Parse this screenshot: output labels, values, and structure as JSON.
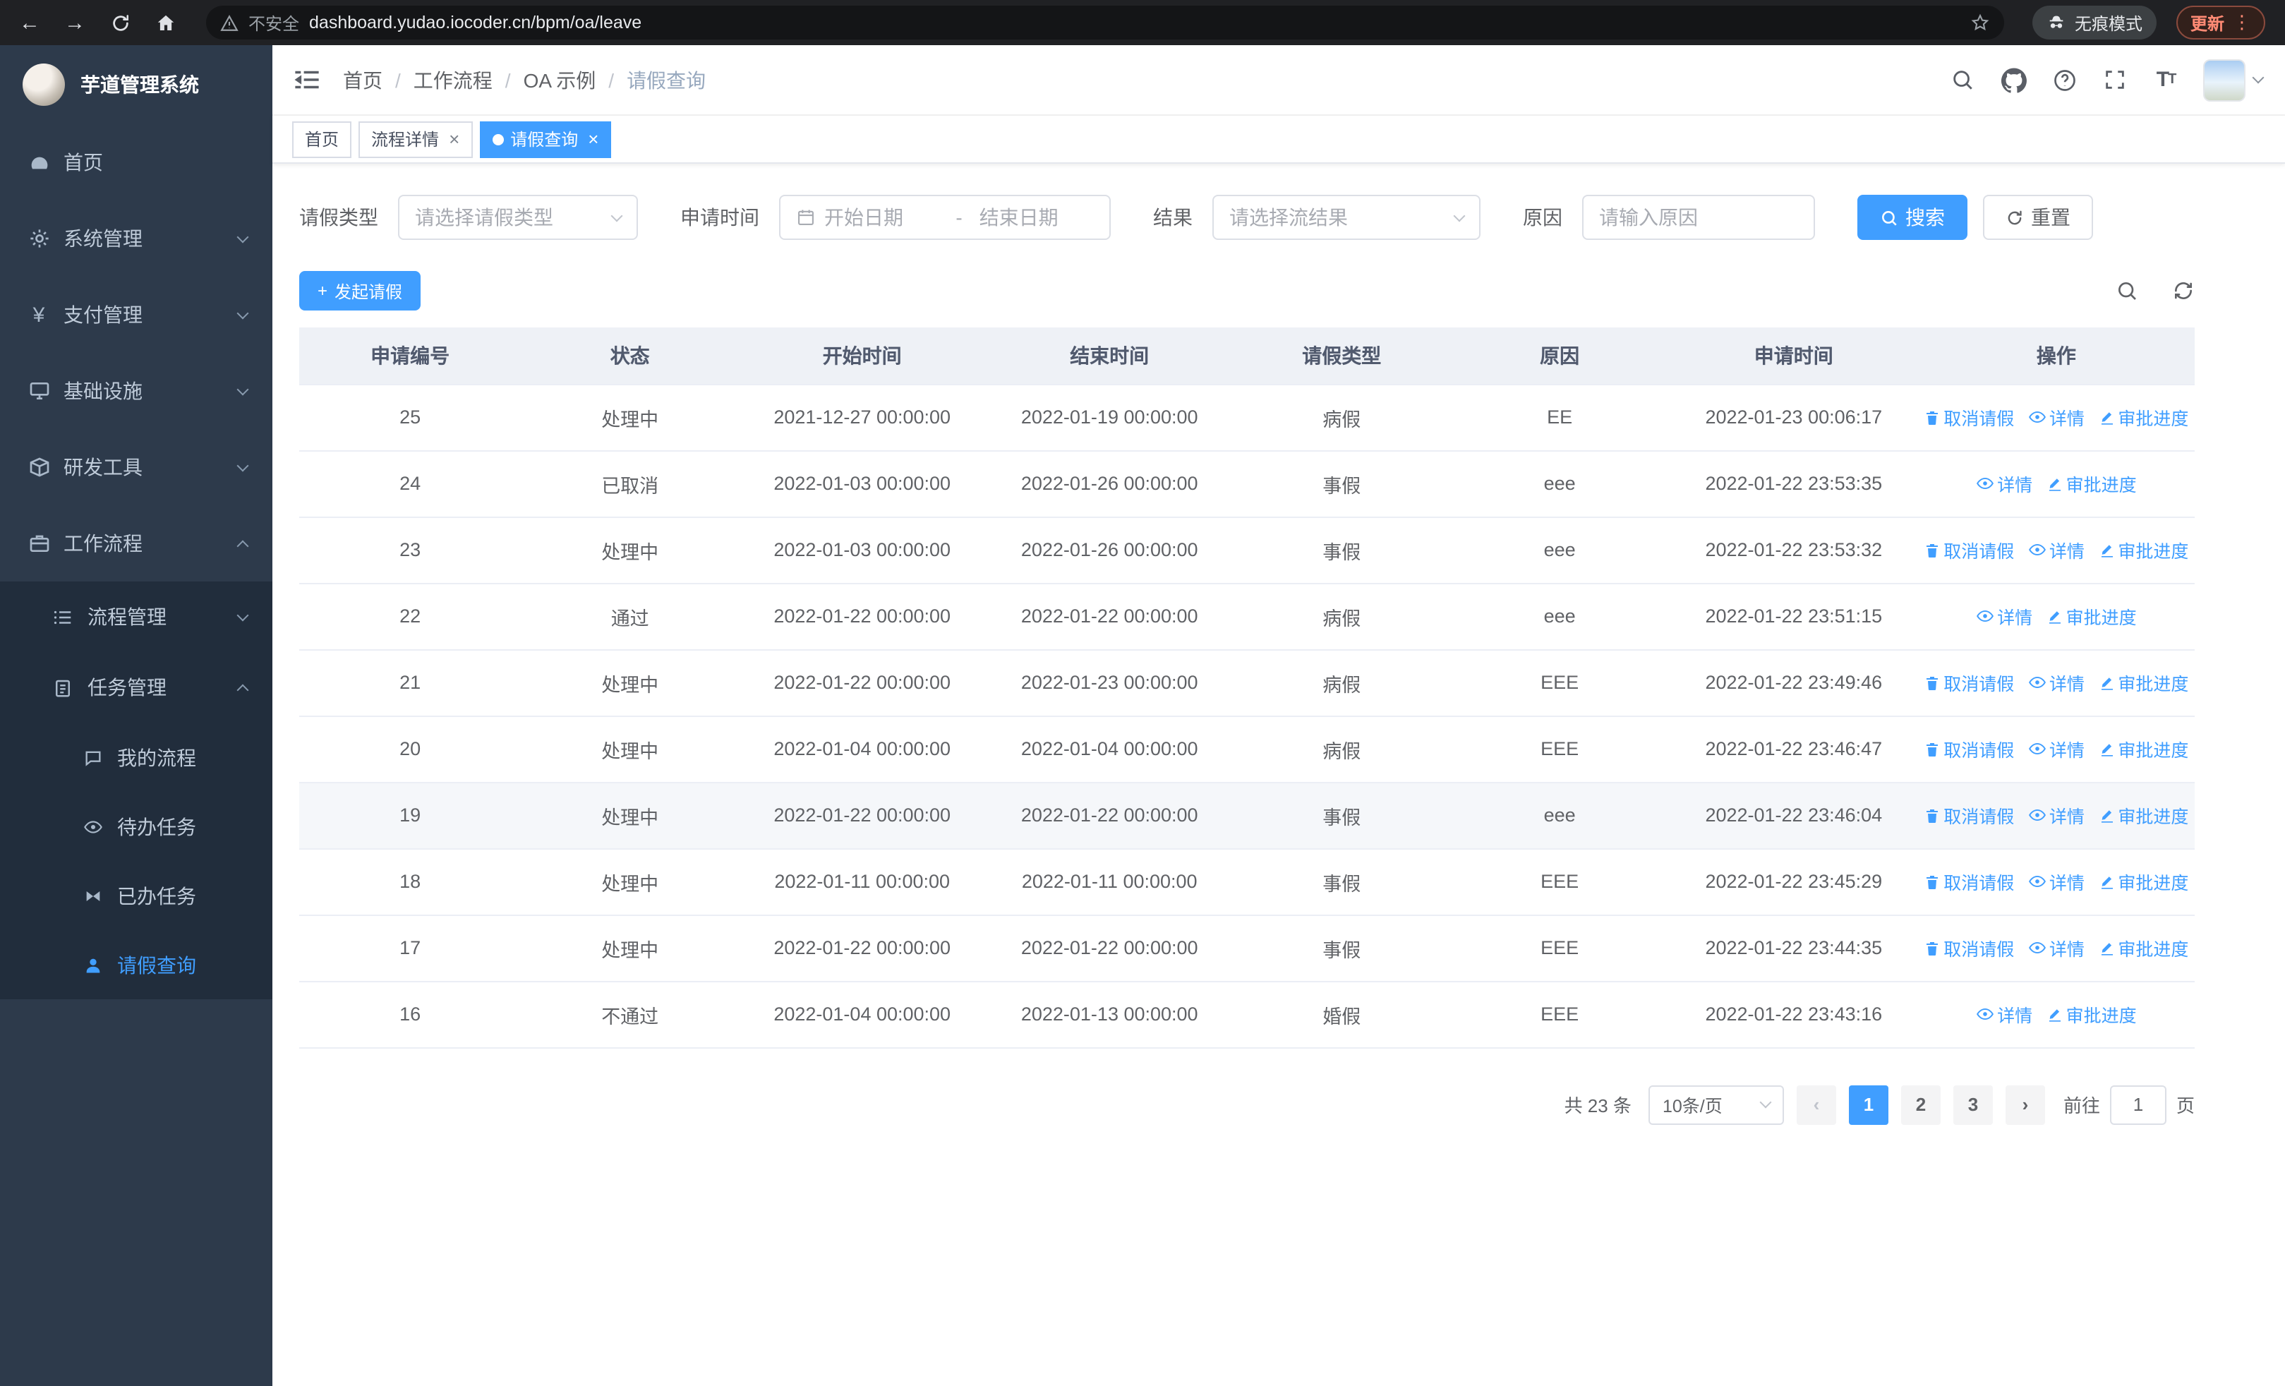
{
  "browser": {
    "security_label": "不安全",
    "url": "dashboard.yudao.iocoder.cn/bpm/oa/leave",
    "incognito_label": "无痕模式",
    "update_label": "更新"
  },
  "sidebar": {
    "title": "芋道管理系统",
    "menu": [
      {
        "label": "首页"
      },
      {
        "label": "系统管理"
      },
      {
        "label": "支付管理"
      },
      {
        "label": "基础设施"
      },
      {
        "label": "研发工具"
      },
      {
        "label": "工作流程"
      },
      {
        "label": "流程管理"
      },
      {
        "label": "任务管理"
      },
      {
        "label": "我的流程"
      },
      {
        "label": "待办任务"
      },
      {
        "label": "已办任务"
      },
      {
        "label": "请假查询"
      }
    ]
  },
  "header": {
    "breadcrumb": [
      "首页",
      "工作流程",
      "OA 示例",
      "请假查询"
    ]
  },
  "tabs": [
    {
      "label": "首页"
    },
    {
      "label": "流程详情"
    },
    {
      "label": "请假查询"
    }
  ],
  "filters": {
    "leave_type_label": "请假类型",
    "leave_type_placeholder": "请选择请假类型",
    "apply_time_label": "申请时间",
    "start_date_placeholder": "开始日期",
    "range_separator": "-",
    "end_date_placeholder": "结束日期",
    "result_label": "结果",
    "result_placeholder": "请选择流结果",
    "reason_label": "原因",
    "reason_placeholder": "请输入原因",
    "search_button": "搜索",
    "reset_button": "重置"
  },
  "toolbar": {
    "create_button": "发起请假"
  },
  "table": {
    "columns": [
      "申请编号",
      "状态",
      "开始时间",
      "结束时间",
      "请假类型",
      "原因",
      "申请时间",
      "操作"
    ],
    "ops": {
      "cancel": "取消请假",
      "detail": "详情",
      "progress": "审批进度"
    },
    "rows": [
      {
        "id": "25",
        "status": "处理中",
        "start": "2021-12-27 00:00:00",
        "end": "2022-01-19 00:00:00",
        "type": "病假",
        "reason": "EE",
        "applied": "2022-01-23 00:06:17",
        "can_cancel": true,
        "highlight": false
      },
      {
        "id": "24",
        "status": "已取消",
        "start": "2022-01-03 00:00:00",
        "end": "2022-01-26 00:00:00",
        "type": "事假",
        "reason": "eee",
        "applied": "2022-01-22 23:53:35",
        "can_cancel": false,
        "highlight": false
      },
      {
        "id": "23",
        "status": "处理中",
        "start": "2022-01-03 00:00:00",
        "end": "2022-01-26 00:00:00",
        "type": "事假",
        "reason": "eee",
        "applied": "2022-01-22 23:53:32",
        "can_cancel": true,
        "highlight": false
      },
      {
        "id": "22",
        "status": "通过",
        "start": "2022-01-22 00:00:00",
        "end": "2022-01-22 00:00:00",
        "type": "病假",
        "reason": "eee",
        "applied": "2022-01-22 23:51:15",
        "can_cancel": false,
        "highlight": false
      },
      {
        "id": "21",
        "status": "处理中",
        "start": "2022-01-22 00:00:00",
        "end": "2022-01-23 00:00:00",
        "type": "病假",
        "reason": "EEE",
        "applied": "2022-01-22 23:49:46",
        "can_cancel": true,
        "highlight": false
      },
      {
        "id": "20",
        "status": "处理中",
        "start": "2022-01-04 00:00:00",
        "end": "2022-01-04 00:00:00",
        "type": "病假",
        "reason": "EEE",
        "applied": "2022-01-22 23:46:47",
        "can_cancel": true,
        "highlight": false
      },
      {
        "id": "19",
        "status": "处理中",
        "start": "2022-01-22 00:00:00",
        "end": "2022-01-22 00:00:00",
        "type": "事假",
        "reason": "eee",
        "applied": "2022-01-22 23:46:04",
        "can_cancel": true,
        "highlight": true
      },
      {
        "id": "18",
        "status": "处理中",
        "start": "2022-01-11 00:00:00",
        "end": "2022-01-11 00:00:00",
        "type": "事假",
        "reason": "EEE",
        "applied": "2022-01-22 23:45:29",
        "can_cancel": true,
        "highlight": false
      },
      {
        "id": "17",
        "status": "处理中",
        "start": "2022-01-22 00:00:00",
        "end": "2022-01-22 00:00:00",
        "type": "事假",
        "reason": "EEE",
        "applied": "2022-01-22 23:44:35",
        "can_cancel": true,
        "highlight": false
      },
      {
        "id": "16",
        "status": "不通过",
        "start": "2022-01-04 00:00:00",
        "end": "2022-01-13 00:00:00",
        "type": "婚假",
        "reason": "EEE",
        "applied": "2022-01-22 23:43:16",
        "can_cancel": false,
        "highlight": false
      }
    ]
  },
  "pagination": {
    "total_text": "共 23 条",
    "page_size": "10条/页",
    "pages": [
      "1",
      "2",
      "3"
    ],
    "goto_label": "前往",
    "goto_value": "1",
    "page_unit": "页"
  },
  "colors": {
    "accent": "#409eff",
    "sidebar_bg": "#2d3a4b",
    "submenu_bg": "#212d3c"
  }
}
